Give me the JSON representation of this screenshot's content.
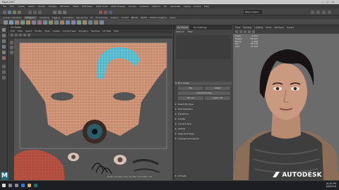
{
  "window": {
    "title": "Maya 2017",
    "workspace": "Maya Classic"
  },
  "menubar": {
    "items": [
      "File",
      "Edit",
      "Create",
      "Select",
      "Modify",
      "Display",
      "Windows",
      "Mesh",
      "Edit Mesh",
      "Mesh Tools",
      "Mesh Display",
      "Curves",
      "Surfaces",
      "Deform",
      "UV",
      "Generate",
      "Cache",
      "Arnold",
      "Help"
    ]
  },
  "shelf": {
    "tabs": [
      "Curves / Surfaces",
      "Polygons",
      "Sculpting",
      "Rigging",
      "Animation",
      "Rendering",
      "FX",
      "FX Caching",
      "Custom",
      "Arnold",
      "Bifrost",
      "MASH",
      "Motion Graphics",
      "XGen"
    ],
    "active_index": 1
  },
  "uv_editor": {
    "title": "UV Editor",
    "menu": [
      "Edit",
      "View",
      "Select",
      "Modify",
      "Tools",
      "Create",
      "Cut and Sew",
      "Polygons",
      "Textures",
      "UV Sets",
      "Help"
    ],
    "status": "Faces: 1/2,392 | UVs: 1/2,392 | UV shells: 4/4"
  },
  "uv_toolkit": {
    "tabs": [
      "UV Toolkit",
      "Tool Settings"
    ],
    "menu": [
      "Options",
      "Help"
    ],
    "sections": [
      "Pin / Unpin",
      "Select By Type",
      "Soft Selection",
      "Transform",
      "Create",
      "Cut and Sew",
      "Unfold",
      "Align and Snap",
      "Arrange and Layout",
      "UV Sets"
    ],
    "buttons": {
      "pin": "Pin",
      "unpin": "Unpin",
      "invert": "Invert Pinning",
      "pin_all": "Pin All",
      "unpin_all": "Unpin All"
    }
  },
  "viewport": {
    "menu": [
      "View",
      "Shading",
      "Lighting",
      "Show",
      "Renderer",
      "Panels"
    ],
    "hud": {
      "labels": [
        "Verts:",
        "Edges:",
        "Faces:",
        "Tris:",
        "UVs:"
      ],
      "values": [
        "9,354",
        "18,642",
        "9,288",
        "18,576",
        "11,932"
      ]
    }
  },
  "branding": {
    "text": "AUTODESK",
    "app_letter": "M"
  },
  "taskbar": {
    "time": "10:40 PM",
    "date": "6/6/2016"
  },
  "colors": {
    "uv_skin": "#c98b6d",
    "uv_wire": "#f4d4bb",
    "uv_selected": "#48b7cc",
    "viewport_bg": "#6b6b6b"
  }
}
